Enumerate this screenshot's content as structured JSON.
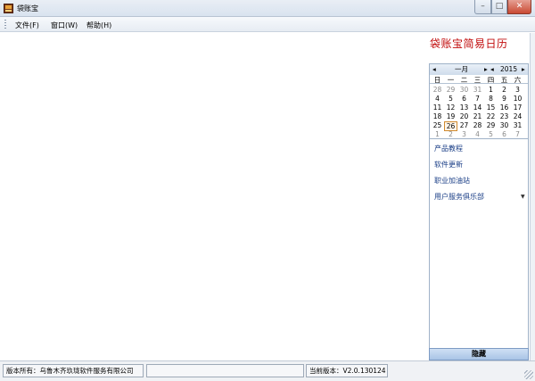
{
  "window": {
    "title": "袋账宝",
    "buttons": {
      "minimize": "–",
      "maximize": "□",
      "close": "✕"
    }
  },
  "menu": [
    {
      "label": "文件(F)"
    },
    {
      "label": "窗口(W)"
    },
    {
      "label": "帮助(H)"
    }
  ],
  "sidebar": {
    "calendar_title": "袋账宝简易日历",
    "calendar": {
      "prev_month": "◂",
      "month": "一月",
      "next_month": "▸",
      "prev_year": "◂",
      "year": "2015",
      "next_year": "▸",
      "weekdays": [
        "日",
        "一",
        "二",
        "三",
        "四",
        "五",
        "六"
      ],
      "weeks": [
        [
          "28",
          "29",
          "30",
          "31",
          "1",
          "2",
          "3"
        ],
        [
          "4",
          "5",
          "6",
          "7",
          "8",
          "9",
          "10"
        ],
        [
          "11",
          "12",
          "13",
          "14",
          "15",
          "16",
          "17"
        ],
        [
          "18",
          "19",
          "20",
          "21",
          "22",
          "23",
          "24"
        ],
        [
          "25",
          "26",
          "27",
          "28",
          "29",
          "30",
          "31"
        ],
        [
          "1",
          "2",
          "3",
          "4",
          "5",
          "6",
          "7"
        ]
      ],
      "today": "26"
    },
    "links": [
      {
        "label": "产品教程"
      },
      {
        "label": "软件更新"
      },
      {
        "label": "职业加油站"
      },
      {
        "label": "用户服务俱乐部"
      }
    ],
    "hide_button": "隐藏"
  },
  "status": {
    "copyright": "版本所有：乌鲁木齐玖珑软件服务有限公司",
    "middle": "",
    "version": "当前版本：V2.0.130124"
  }
}
